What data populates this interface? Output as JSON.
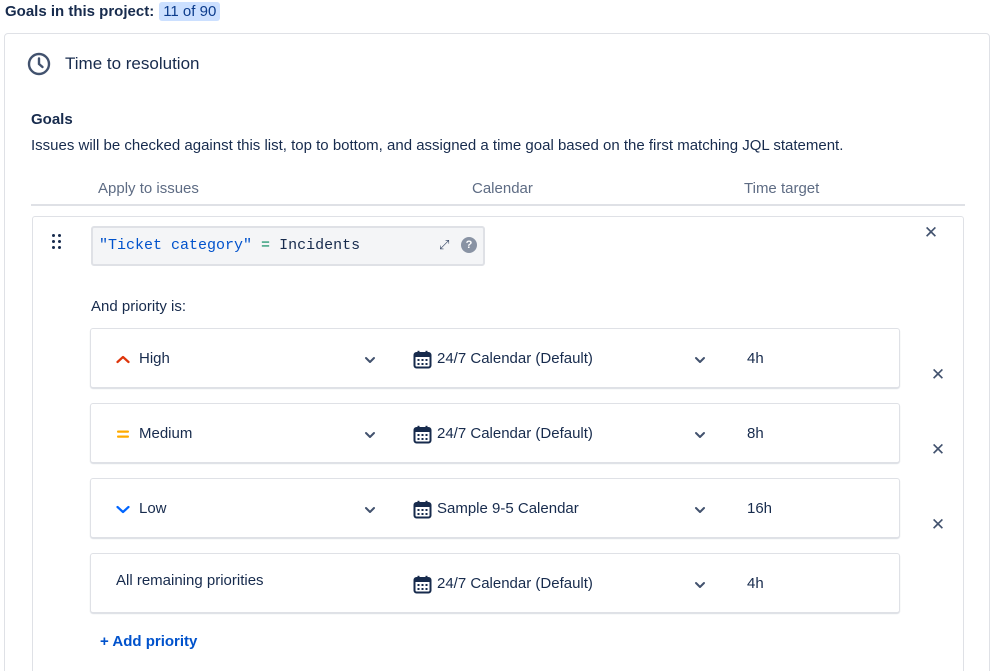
{
  "header": {
    "label": "Goals in this project:",
    "count": "11 of 90"
  },
  "card": {
    "title": "Time to resolution",
    "icon": "clock-icon",
    "goals_heading": "Goals",
    "goals_description": "Issues will be checked against this list, top to bottom, and assigned a time goal based on the first matching JQL statement.",
    "columns": {
      "apply": "Apply to issues",
      "calendar": "Calendar",
      "time_target": "Time target"
    }
  },
  "rule": {
    "jql": {
      "field": "\"Ticket category\"",
      "operator": "=",
      "value": "Incidents",
      "help": "?"
    },
    "close_label": "✕",
    "priority_label": "And priority is:",
    "priorities": [
      {
        "name": "High",
        "icon": "priority-high-icon",
        "color": "#de350b",
        "calendar": "24/7 Calendar (Default)",
        "time": "4h"
      },
      {
        "name": "Medium",
        "icon": "priority-medium-icon",
        "color": "#ffab00",
        "calendar": "24/7 Calendar (Default)",
        "time": "8h"
      },
      {
        "name": "Low",
        "icon": "priority-low-icon",
        "color": "#0065ff",
        "calendar": "Sample 9-5 Calendar",
        "time": "16h"
      },
      {
        "name": "All remaining priorities",
        "icon": "",
        "color": "",
        "calendar": "24/7 Calendar (Default)",
        "time": "4h"
      }
    ],
    "add_priority": "+ Add priority"
  },
  "colors": {
    "accent": "#0052cc",
    "badge_bg": "#cce0ff",
    "text": "#172b4d",
    "muted": "#5e6c84",
    "border": "#dfe1e6"
  }
}
